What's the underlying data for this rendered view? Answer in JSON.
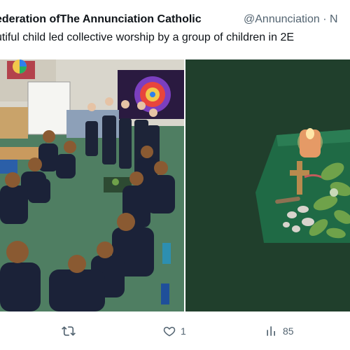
{
  "tweet": {
    "author_name": "ederation ofThe Annunciation Catholic",
    "author_handle": "@Annunciation",
    "separator": "·",
    "date_fragment": "N",
    "text": "utiful child led collective worship by a group of children in 2E"
  },
  "actions": {
    "reply_count": "",
    "retweet_count": "",
    "like_count": "1",
    "views_count": "85"
  },
  "icons": {
    "retweet": "retweet-icon",
    "like": "heart-icon",
    "views": "views-icon"
  },
  "colors": {
    "text_primary": "#0f1419",
    "text_secondary": "#536471"
  }
}
